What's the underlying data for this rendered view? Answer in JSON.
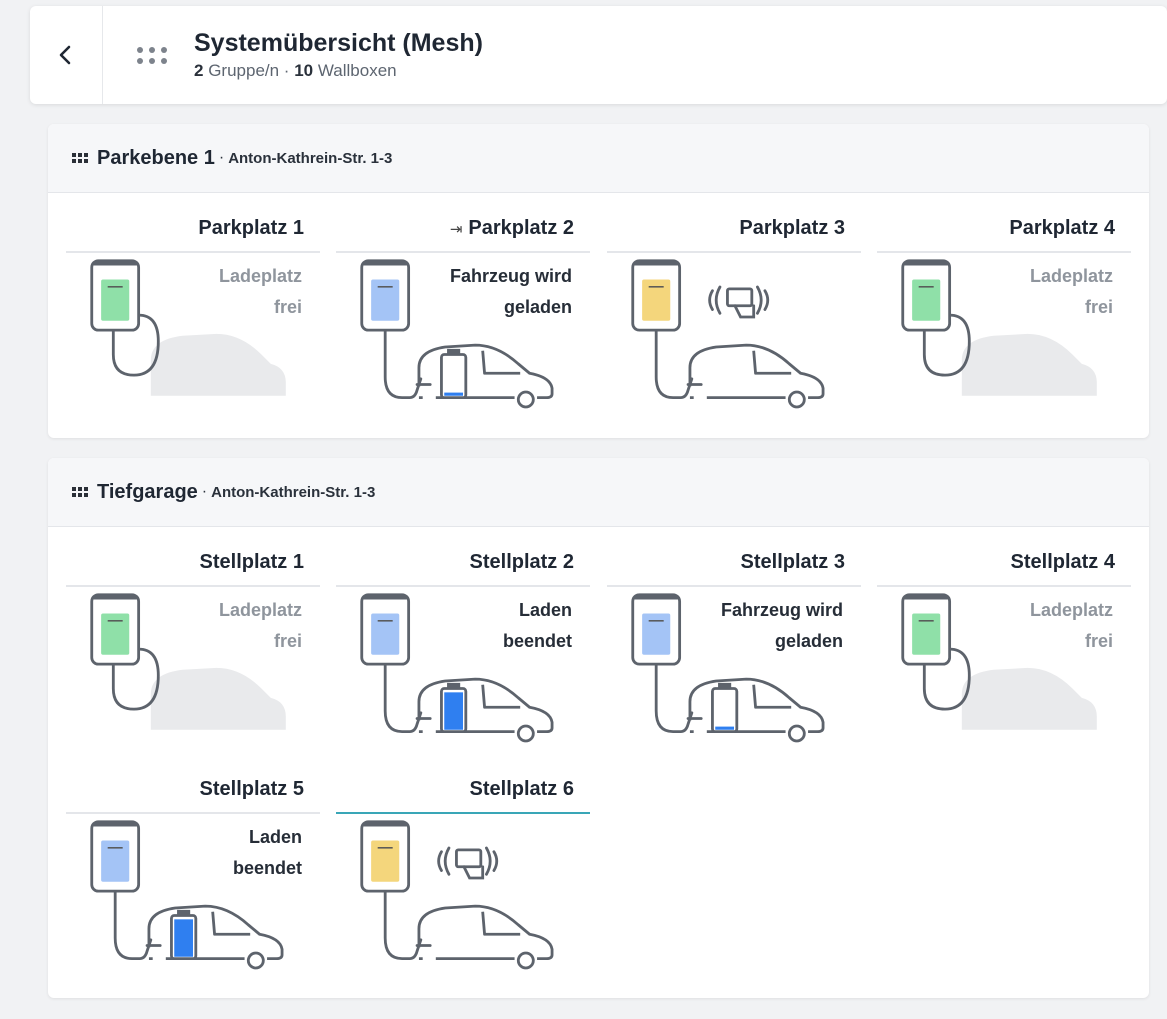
{
  "header": {
    "title": "Systemübersicht (Mesh)",
    "groups_count": "2",
    "groups_label": "Gruppe/n ·",
    "wallboxes_count": "10",
    "wallboxes_label": "Wallboxen"
  },
  "groups": [
    {
      "name": "Parkebene 1",
      "separator": "·",
      "address": "Anton-Kathrein-Str. 1-3",
      "tiles": [
        {
          "title": "Parkplatz 1",
          "line1": "Ladeplatz",
          "line2": "frei"
        },
        {
          "title": "Parkplatz 2",
          "line1": "Fahrzeug wird",
          "line2": "geladen"
        },
        {
          "title": "Parkplatz 3"
        },
        {
          "title": "Parkplatz 4",
          "line1": "Ladeplatz",
          "line2": "frei"
        }
      ]
    },
    {
      "name": "Tiefgarage",
      "separator": "·",
      "address": "Anton-Kathrein-Str. 1-3",
      "tiles": [
        {
          "title": "Stellplatz 1",
          "line1": "Ladeplatz",
          "line2": "frei"
        },
        {
          "title": "Stellplatz 2",
          "line1": "Laden",
          "line2": "beendet"
        },
        {
          "title": "Stellplatz 3",
          "line1": "Fahrzeug wird",
          "line2": "geladen"
        },
        {
          "title": "Stellplatz 4",
          "line1": "Ladeplatz",
          "line2": "frei"
        },
        {
          "title": "Stellplatz 5",
          "line1": "Laden",
          "line2": "beendet"
        },
        {
          "title": "Stellplatz 6"
        }
      ]
    }
  ],
  "colors": {
    "free": "#8fe0a8",
    "charging": "#a4c4f6",
    "auth": "#f4d67c",
    "battery_blue": "#2f7ff0",
    "selected_line": "#39a6b7"
  }
}
